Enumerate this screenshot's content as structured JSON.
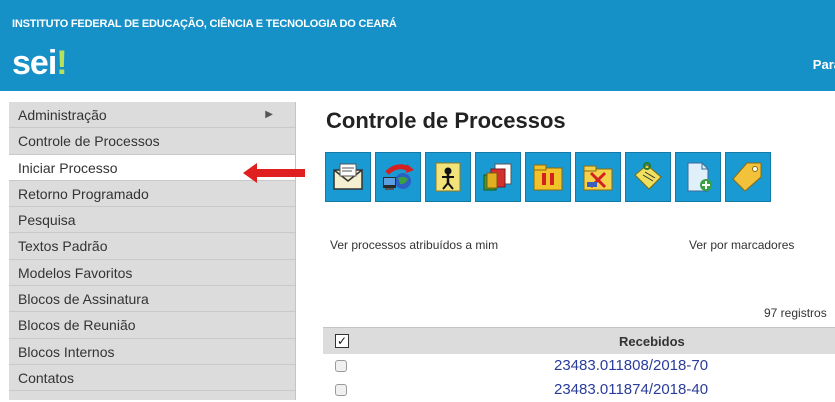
{
  "header": {
    "institution": "INSTITUTO FEDERAL DE EDUCAÇÃO, CIÊNCIA E TECNOLOGIA DO CEARÁ",
    "logo": "sei",
    "logo_dot": "!",
    "right_text": "Para"
  },
  "sidebar": {
    "items": [
      {
        "label": "Administração",
        "chevron": "▶"
      },
      {
        "label": "Controle de Processos"
      },
      {
        "label": "Iniciar Processo"
      },
      {
        "label": "Retorno Programado"
      },
      {
        "label": "Pesquisa"
      },
      {
        "label": "Textos Padrão"
      },
      {
        "label": "Modelos Favoritos"
      },
      {
        "label": "Blocos de Assinatura"
      },
      {
        "label": "Blocos de Reunião"
      },
      {
        "label": "Blocos Internos"
      },
      {
        "label": "Contatos"
      }
    ]
  },
  "main": {
    "title": "Controle de Processos",
    "toolbar_icons": [
      "envelope-icon",
      "globe-transfer-icon",
      "assign-person-icon",
      "documents-icon",
      "pause-icon",
      "close-folder-icon",
      "sticky-note-icon",
      "new-document-icon",
      "tag-icon"
    ],
    "link_left": "Ver processos atribuídos a mim",
    "link_right": "Ver por marcadores",
    "records": "97 registros",
    "table": {
      "check_all": "✓",
      "header": "Recebidos",
      "rows": [
        "23483.011808/2018-70",
        "23483.011874/2018-40"
      ]
    }
  },
  "colors": {
    "brand": "#1591c8",
    "sidebar": "#dcdcdc",
    "link": "#2a3c9b",
    "arrow": "#e02020"
  }
}
